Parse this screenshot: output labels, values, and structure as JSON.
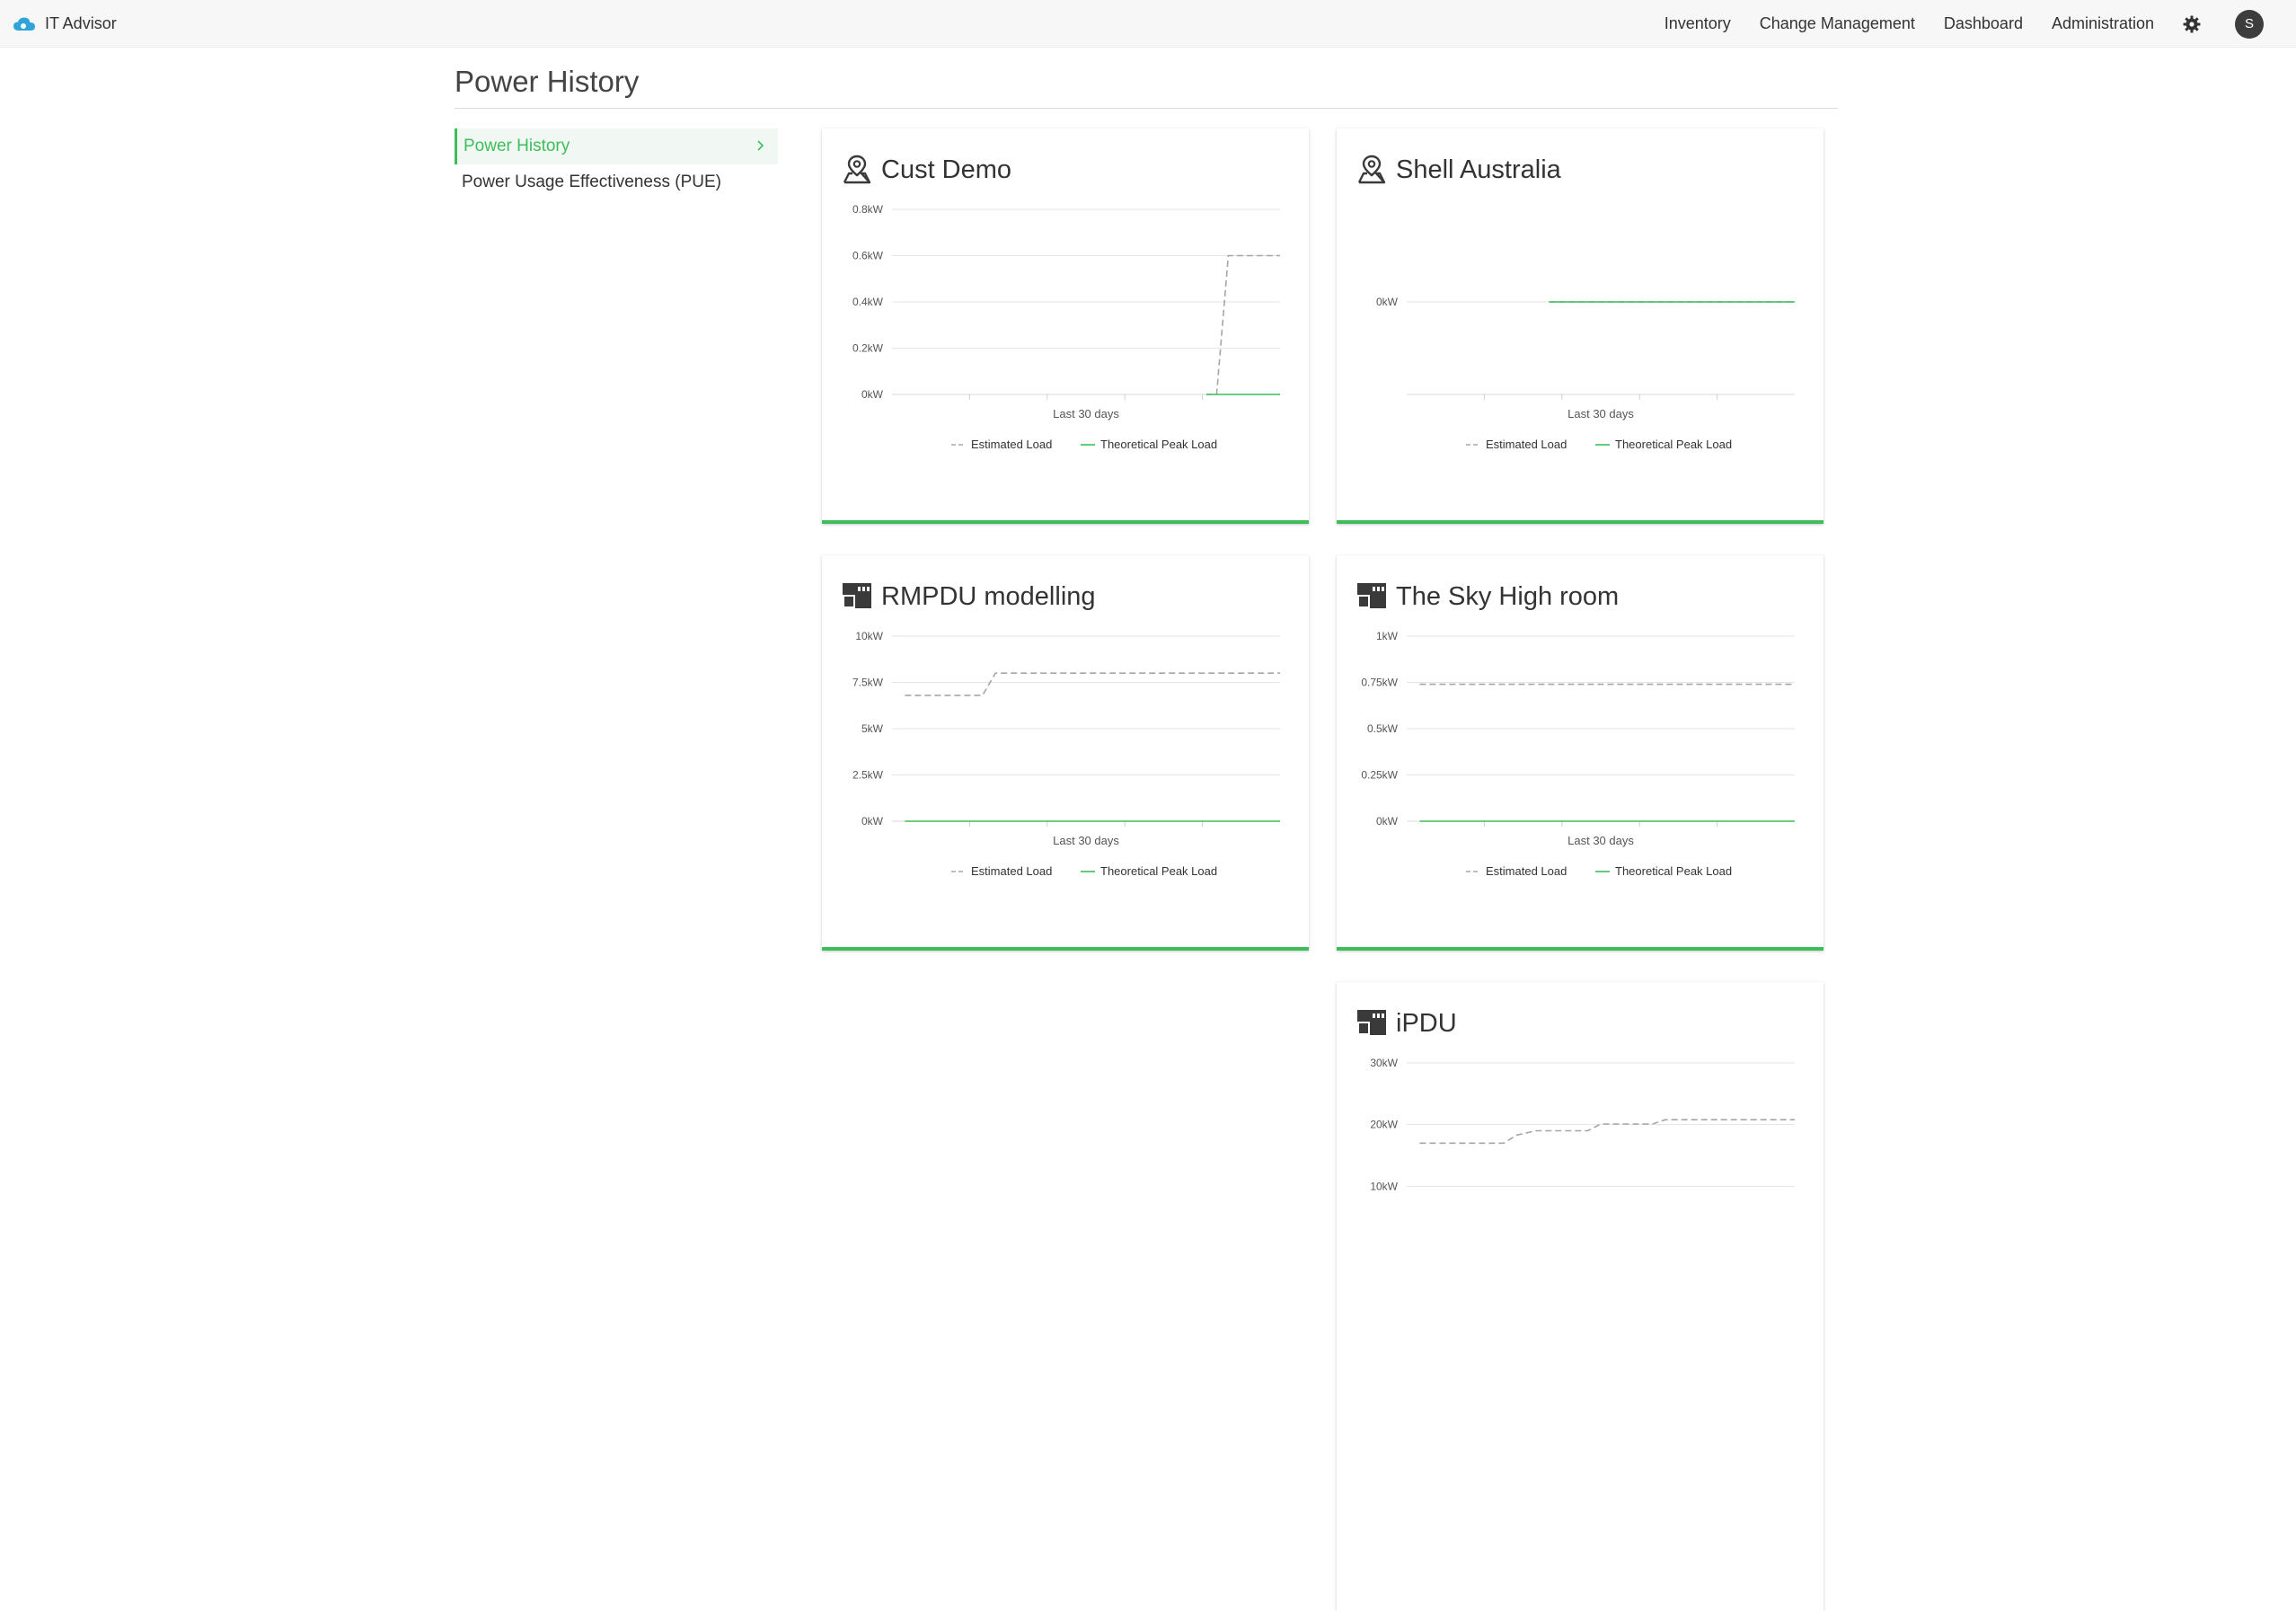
{
  "app": {
    "name": "IT Advisor"
  },
  "nav": {
    "items": [
      "Inventory",
      "Change Management",
      "Dashboard",
      "Administration"
    ],
    "avatar_initial": "S"
  },
  "page": {
    "title": "Power History"
  },
  "sidebar": {
    "items": [
      {
        "label": "Power History",
        "active": true
      },
      {
        "label": "Power Usage Effectiveness (PUE)",
        "active": false
      }
    ]
  },
  "colors": {
    "accent": "#3dbe5a",
    "estimated": "#a6a6a6",
    "peak": "#3dbe5a",
    "icon": "#3a3a3a"
  },
  "legend": {
    "estimated": "Estimated Load",
    "peak": "Theoretical Peak Load"
  },
  "chart_data": [
    {
      "title": "Cust Demo",
      "icon": "location-pin-icon",
      "type": "line",
      "xlabel": "Last 30 days",
      "ylim": [
        0,
        0.8
      ],
      "yticks": [
        {
          "v": 0,
          "label": "0kW"
        },
        {
          "v": 0.2,
          "label": "0.2kW"
        },
        {
          "v": 0.4,
          "label": "0.4kW"
        },
        {
          "v": 0.6,
          "label": "0.6kW"
        },
        {
          "v": 0.8,
          "label": "0.8kW"
        }
      ],
      "xlim": [
        0,
        30
      ],
      "series": [
        {
          "name": "Estimated Load",
          "x": [
            24.3,
            25.1,
            26.0,
            30
          ],
          "y": [
            0,
            0,
            0.6,
            0.6
          ]
        },
        {
          "name": "Theoretical Peak Load",
          "x": [
            24.3,
            30
          ],
          "y": [
            0,
            0
          ]
        }
      ]
    },
    {
      "title": "Shell Australia",
      "icon": "location-pin-icon",
      "type": "line",
      "xlabel": "Last 30 days",
      "ylim": [
        -1,
        1
      ],
      "yticks": [
        {
          "v": 0,
          "label": "0kW"
        }
      ],
      "xlim": [
        0,
        30
      ],
      "series": [
        {
          "name": "Estimated Load",
          "x": [
            11,
            30
          ],
          "y": [
            0,
            0
          ]
        },
        {
          "name": "Theoretical Peak Load",
          "x": [
            11,
            30
          ],
          "y": [
            0,
            0
          ]
        }
      ]
    },
    {
      "title": "RMPDU modelling",
      "icon": "rack-pdu-icon",
      "type": "line",
      "xlabel": "Last 30 days",
      "ylim": [
        0,
        10
      ],
      "yticks": [
        {
          "v": 0,
          "label": "0kW"
        },
        {
          "v": 2.5,
          "label": "2.5kW"
        },
        {
          "v": 5,
          "label": "5kW"
        },
        {
          "v": 7.5,
          "label": "7.5kW"
        },
        {
          "v": 10,
          "label": "10kW"
        }
      ],
      "xlim": [
        0,
        30
      ],
      "series": [
        {
          "name": "Estimated Load",
          "x": [
            1,
            7,
            8,
            30
          ],
          "y": [
            6.8,
            6.8,
            8,
            8
          ]
        },
        {
          "name": "Theoretical Peak Load",
          "x": [
            1,
            30
          ],
          "y": [
            0,
            0
          ]
        }
      ]
    },
    {
      "title": "The Sky High room",
      "icon": "rack-pdu-icon",
      "type": "line",
      "xlabel": "Last 30 days",
      "ylim": [
        0,
        1
      ],
      "yticks": [
        {
          "v": 0,
          "label": "0kW"
        },
        {
          "v": 0.25,
          "label": "0.25kW"
        },
        {
          "v": 0.5,
          "label": "0.5kW"
        },
        {
          "v": 0.75,
          "label": "0.75kW"
        },
        {
          "v": 1,
          "label": "1kW"
        }
      ],
      "xlim": [
        0,
        30
      ],
      "series": [
        {
          "name": "Estimated Load",
          "x": [
            1,
            30
          ],
          "y": [
            0.74,
            0.74
          ]
        },
        {
          "name": "Theoretical Peak Load",
          "x": [
            1,
            30
          ],
          "y": [
            0,
            0
          ]
        }
      ]
    },
    {
      "title": "iPDU",
      "icon": "rack-pdu-icon",
      "type": "line",
      "xlabel": "",
      "ylim": [
        0,
        30
      ],
      "yticks": [
        {
          "v": 10,
          "label": "10kW"
        },
        {
          "v": 20,
          "label": "20kW"
        },
        {
          "v": 30,
          "label": "30kW"
        }
      ],
      "xlim": [
        0,
        30
      ],
      "series": [
        {
          "name": "Estimated Load",
          "x": [
            1,
            7.5,
            8.5,
            10,
            14,
            15,
            19,
            20,
            30
          ],
          "y": [
            17,
            17,
            18.3,
            19,
            19,
            20.1,
            20.1,
            20.8,
            20.8
          ]
        }
      ]
    }
  ]
}
